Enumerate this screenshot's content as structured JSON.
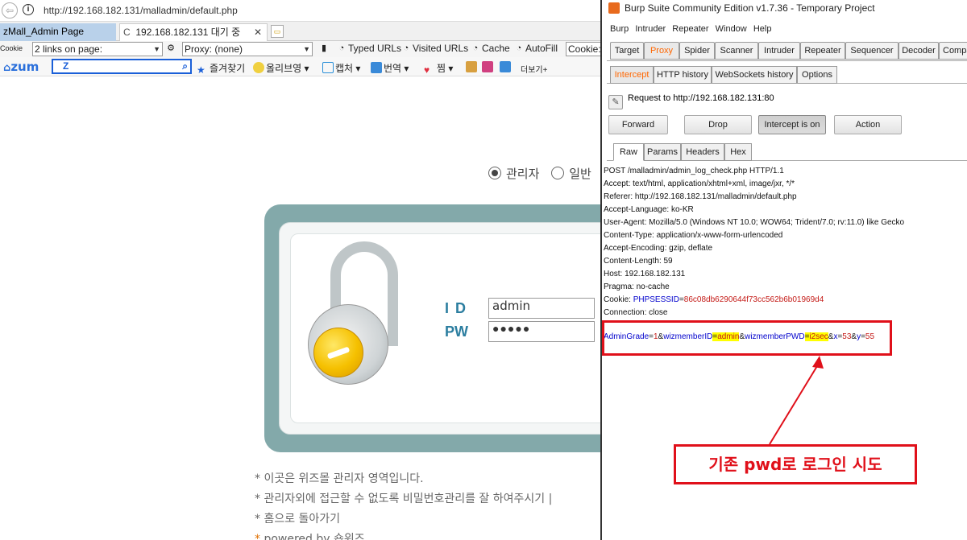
{
  "browser": {
    "url": "http://192.168.182.131/malladmin/default.php",
    "tabs": [
      {
        "label": "zMall_Admin Page"
      },
      {
        "label": "192.168.182.131 대기 중"
      }
    ],
    "toolbar1": {
      "cookie_label": "Cookie",
      "links_select": "2 links on page:",
      "proxy_select": "Proxy: (none)",
      "typed_urls": "Typed URLs",
      "visited_urls": "Visited URLs",
      "cache": "Cache",
      "autofill": "AutoFill",
      "cookie_field": "Cookie:"
    },
    "toolbar2": {
      "logo": "zum",
      "search_value": "Z",
      "favorites": "즐겨찾기",
      "olive": "올리브영",
      "capture": "캡처",
      "translate": "번역",
      "jjim": "찜",
      "more": "더보기+"
    },
    "page": {
      "radio_admin": "관리자",
      "radio_general": "일반",
      "id_label": "ID",
      "pw_label": "PW",
      "id_value": "admin",
      "pw_value": "●●●●●",
      "notes": [
        "* 이곳은 위즈몰 관리자 영역입니다.",
        "* 관리자외에 접근할 수 없도록 비밀번호관리를 잘 하여주시기 |",
        "* 홈으로 돌아가기"
      ],
      "powered_star": "*",
      "powered_text": "powered by 숍위즈"
    }
  },
  "burp": {
    "title": "Burp Suite Community Edition v1.7.36 - Temporary Project",
    "menu": [
      "Burp",
      "Intruder",
      "Repeater",
      "Window",
      "Help"
    ],
    "main_tabs": [
      "Target",
      "Proxy",
      "Spider",
      "Scanner",
      "Intruder",
      "Repeater",
      "Sequencer",
      "Decoder",
      "Compa"
    ],
    "active_main_tab": "Proxy",
    "sub_tabs": [
      "Intercept",
      "HTTP history",
      "WebSockets history",
      "Options"
    ],
    "active_sub_tab": "Intercept",
    "request_to": "Request to http://192.168.182.131:80",
    "buttons": {
      "forward": "Forward",
      "drop": "Drop",
      "intercept": "Intercept is on",
      "action": "Action"
    },
    "view_tabs": [
      "Raw",
      "Params",
      "Headers",
      "Hex"
    ],
    "active_view_tab": "Raw",
    "headers": [
      "POST /malladmin/admin_log_check.php HTTP/1.1",
      "Accept: text/html, application/xhtml+xml, image/jxr, */*",
      "Referer: http://192.168.182.131/malladmin/default.php",
      "Accept-Language: ko-KR",
      "User-Agent: Mozilla/5.0 (Windows NT 10.0; WOW64; Trident/7.0; rv:11.0) like Gecko",
      "Content-Type: application/x-www-form-urlencoded",
      "Accept-Encoding: gzip, deflate",
      "Content-Length: 59",
      "Host: 192.168.182.131",
      "Pragma: no-cache"
    ],
    "cookie_prefix": "Cookie: ",
    "cookie_key": "PHPSESSID",
    "cookie_eq": "=",
    "cookie_value": "86c08db6290644f73cc562b6b01969d4",
    "connection": "Connection: close",
    "body": {
      "k1": "AdminGrade",
      "v1": "1",
      "k2": "wizmemberID",
      "v2": "admin",
      "k3": "wizmemberPWD",
      "v3": "i2sec",
      "k4": "x",
      "v4": "53",
      "k5": "y",
      "v5": "55"
    },
    "annotation": "기존 pwd로 로그인 시도"
  },
  "colors": {
    "accent_orange": "#ff6600",
    "annotation_red": "#e0101a",
    "highlight_yellow": "#ffff00",
    "login_teal": "#83a9aa"
  }
}
